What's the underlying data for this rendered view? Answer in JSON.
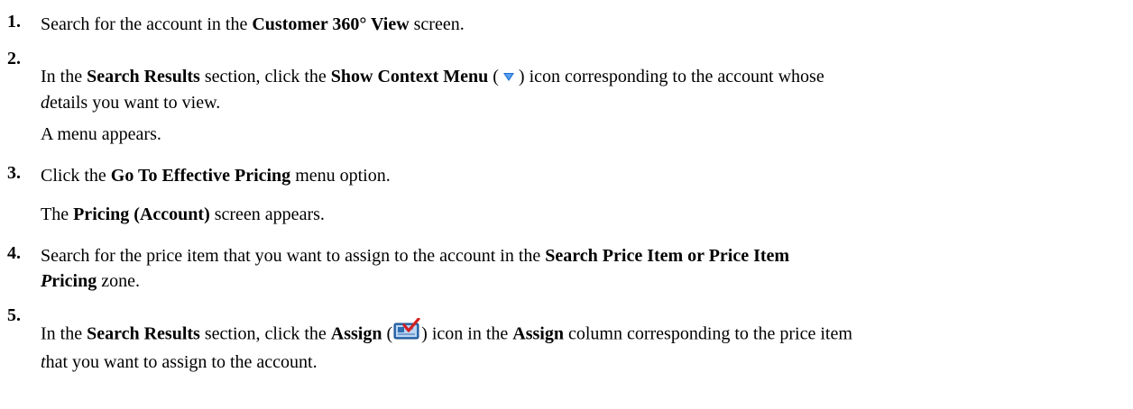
{
  "steps": [
    {
      "num": "1.",
      "segments": [
        {
          "t": "Search for the account in the ",
          "b": false
        },
        {
          "t": "Customer 360° View",
          "b": true
        },
        {
          "t": " screen.",
          "b": false
        }
      ]
    },
    {
      "num": "2.",
      "segments": [
        {
          "t": "In the ",
          "b": false
        },
        {
          "t": "Search Results",
          "b": true
        },
        {
          "t": " section, click the ",
          "b": false
        },
        {
          "t": "Show Context Menu",
          "b": true
        },
        {
          "t": " (",
          "b": false
        }
      ],
      "icon": "chevron-down-icon",
      "segments_after": [
        {
          "t": ") icon corresponding to the account whose",
          "b": false
        }
      ],
      "line2_italic": "d",
      "line2_rest": "etails you want to view.",
      "result": "A menu appears."
    },
    {
      "num": "3.",
      "segments": [
        {
          "t": "Click the ",
          "b": false
        },
        {
          "t": "Go To Effective Pricing",
          "b": true
        },
        {
          "t": " menu option.",
          "b": false
        }
      ],
      "result_segments": [
        {
          "t": "The ",
          "b": false
        },
        {
          "t": "Pricing (Account)",
          "b": true
        },
        {
          "t": " screen appears.",
          "b": false
        }
      ]
    },
    {
      "num": "4.",
      "segments": [
        {
          "t": "Search for the price item that you want to assign to the account in the ",
          "b": false
        },
        {
          "t": "Search Price Item or Price Item",
          "b": true
        }
      ],
      "line2_bi": "P",
      "line2_b": "ricing",
      "line2_rest": " zone."
    },
    {
      "num": "5.",
      "segments": [
        {
          "t": "In the ",
          "b": false
        },
        {
          "t": "Search Results",
          "b": true
        },
        {
          "t": " section, click the ",
          "b": false
        },
        {
          "t": "Assign",
          "b": true
        },
        {
          "t": " (",
          "b": false
        }
      ],
      "icon": "assign-icon",
      "segments_after": [
        {
          "t": ") icon in the ",
          "b": false
        },
        {
          "t": "Assign",
          "b": true
        },
        {
          "t": " column corresponding to the price item",
          "b": false
        }
      ],
      "line2_italic": "t",
      "line2_rest": "hat you want to assign to the account."
    }
  ],
  "colors": {
    "chevron": "#1a6fd6",
    "assign_bg": "#2f6fb3",
    "assign_check": "#d42020"
  }
}
